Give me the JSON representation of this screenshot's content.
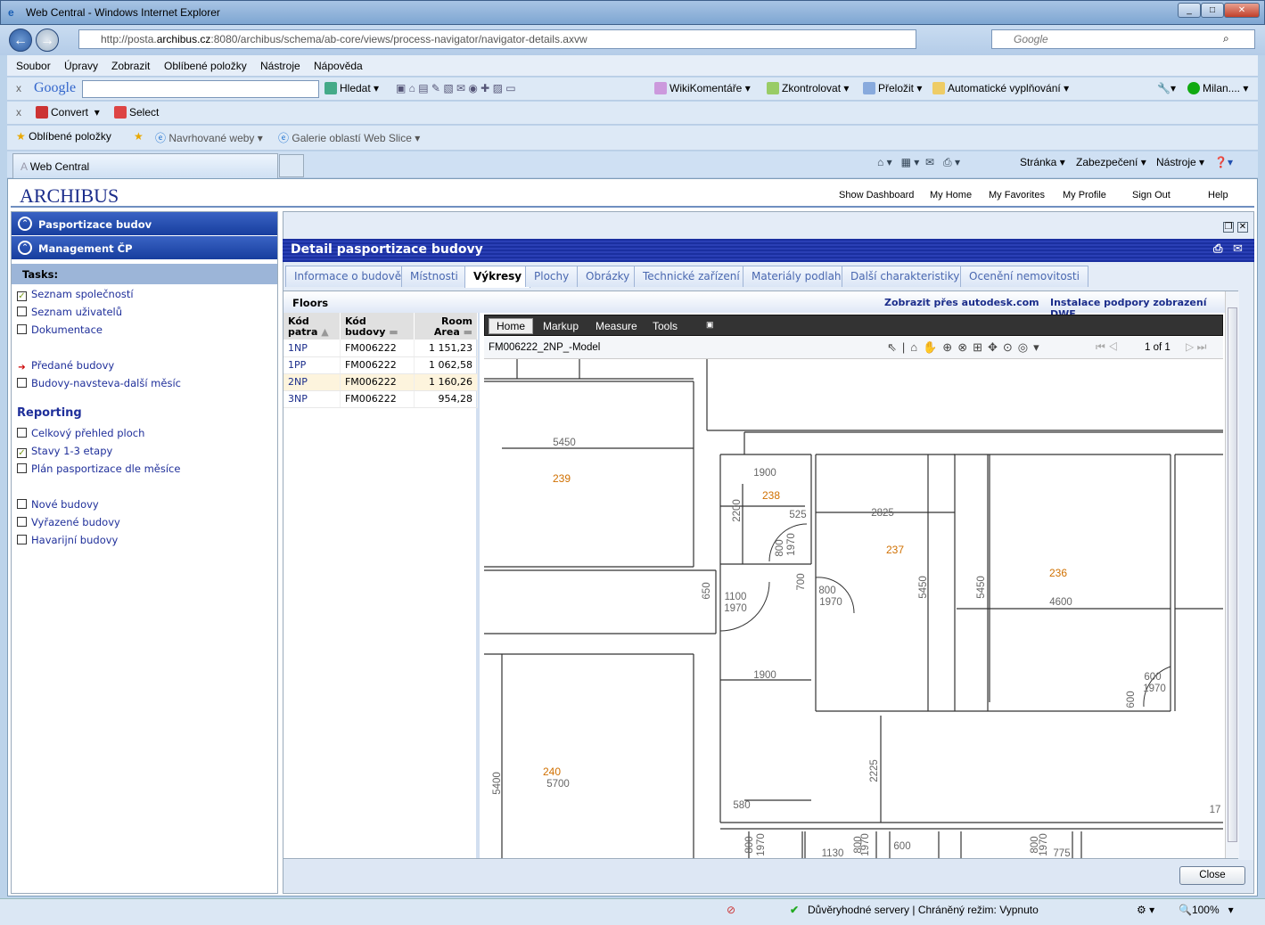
{
  "window": {
    "title": "Web Central - Windows Internet Explorer",
    "url_prefix": "http://posta.",
    "url_host": "archibus.cz",
    "url_rest": ":8080/archibus/schema/ab-core/views/process-navigator/navigator-details.axvw",
    "search_placeholder": "Google"
  },
  "menu": [
    "Soubor",
    "Úpravy",
    "Zobrazit",
    "Oblíbené položky",
    "Nástroje",
    "Nápověda"
  ],
  "google_bar": {
    "logo": "Google",
    "search": "Hledat",
    "wiki": "WikiKomentáře",
    "check": "Zkontrolovat",
    "translate": "Přeložit",
    "autofill": "Automatické vyplňování",
    "user": "Milan...."
  },
  "convert_bar": {
    "convert": "Convert",
    "select": "Select"
  },
  "favorites_bar": {
    "favorites": "Oblíbené položky",
    "suggested": "Navrhované weby",
    "gallery": "Galerie oblastí Web Slice"
  },
  "tab": {
    "label": "Web Central"
  },
  "ie_commands": [
    "Stránka",
    "Zabezpečení",
    "Nástroje"
  ],
  "app": {
    "logo": "ARCHIBUS",
    "links": [
      "Show Dashboard",
      "My Home",
      "My Favorites",
      "My Profile",
      "Sign Out",
      "Help"
    ]
  },
  "sidebar": {
    "sections": [
      "Pasportizace budov",
      "Management ČP"
    ],
    "tasks_label": "Tasks:",
    "groups": [
      [
        {
          "label": "Seznam společností",
          "mark": "check"
        },
        {
          "label": "Seznam uživatelů",
          "mark": "box"
        },
        {
          "label": "Dokumentace",
          "mark": "box"
        }
      ],
      [
        {
          "label": "Předané budovy",
          "mark": "arrow"
        },
        {
          "label": "Budovy-navsteva-další měsíc",
          "mark": "box"
        }
      ]
    ],
    "reporting_label": "Reporting",
    "reporting": [
      {
        "label": "Celkový přehled ploch",
        "mark": "box"
      },
      {
        "label": "Stavy 1-3 etapy",
        "mark": "check"
      },
      {
        "label": "Plán pasportizace dle měsíce",
        "mark": "box"
      }
    ],
    "other": [
      {
        "label": "Nové budovy",
        "mark": "box"
      },
      {
        "label": "Vyřazené budovy",
        "mark": "box"
      },
      {
        "label": "Havarijní budovy",
        "mark": "box"
      }
    ]
  },
  "detail": {
    "title": "Detail pasportizace budovy",
    "tabs": [
      "Informace o budově",
      "Místnosti",
      "Výkresy",
      "Plochy",
      "Obrázky",
      "Technické zařízení",
      "Materiály podlah",
      "Další charakteristiky",
      "Ocenění nemovitosti"
    ],
    "active_tab": "Výkresy",
    "floors_title": "Floors",
    "link_autodesk": "Zobrazit přes autodesk.com",
    "link_dwf": "Instalace podpory zobrazení DWF",
    "columns": [
      "Kód patra",
      "Kód budovy",
      "Room Area"
    ],
    "rows": [
      [
        "1NP",
        "FM006222",
        "1 151,23"
      ],
      [
        "1PP",
        "FM006222",
        "1 062,58"
      ],
      [
        "2NP",
        "FM006222",
        "1 160,26"
      ],
      [
        "3NP",
        "FM006222",
        "954,28"
      ]
    ],
    "selected_row": 2,
    "close": "Close"
  },
  "viewer": {
    "menu": [
      "Home",
      "Markup",
      "Measure",
      "Tools"
    ],
    "model": "FM006222_2NP_-Model",
    "page": "1 of 1",
    "rooms": [
      {
        "t": "239"
      },
      {
        "t": "238"
      },
      {
        "t": "237"
      },
      {
        "t": "236"
      },
      {
        "t": "240"
      }
    ],
    "dims": [
      "5450",
      "1900",
      "2200",
      "525",
      "800",
      "1970",
      "2825",
      "5450",
      "5450",
      "4600",
      "650",
      "1100",
      "1970",
      "700",
      "800",
      "1970",
      "1900",
      "600",
      "1970",
      "600",
      "2225",
      "5700",
      "5400",
      "580",
      "17",
      "1130",
      "600",
      "775",
      "800",
      "1970",
      "800",
      "1970",
      "800",
      "1970"
    ],
    "room_color": "#d07000"
  },
  "status": {
    "zone": "Důvěryhodné servery | Chráněný režim: Vypnuto",
    "zoom": "100%"
  }
}
